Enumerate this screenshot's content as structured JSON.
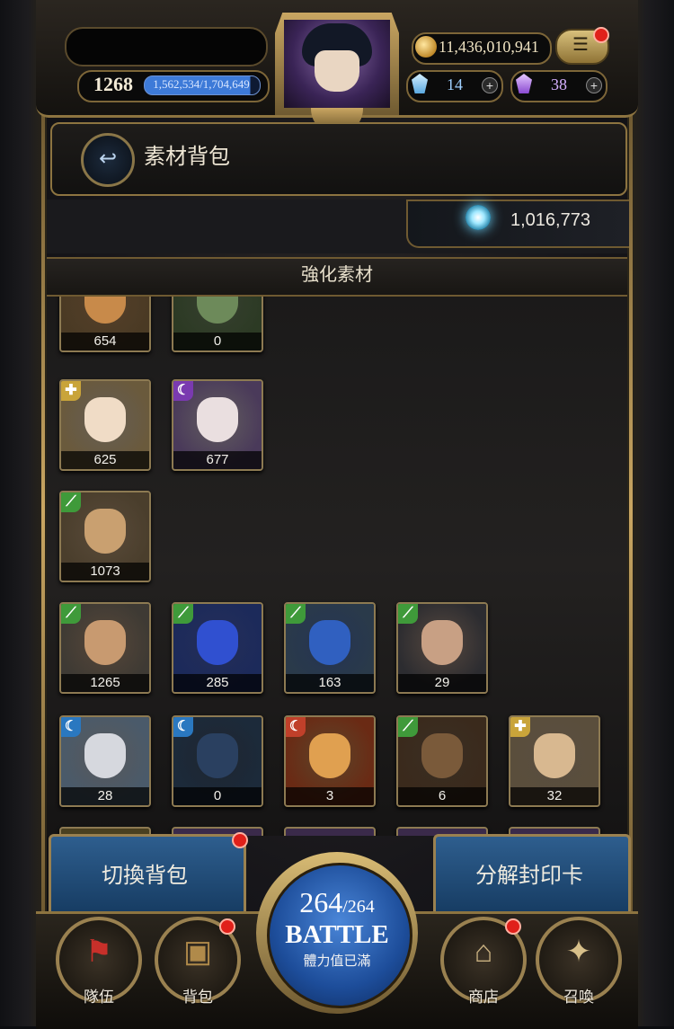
{
  "player": {
    "level": "1268",
    "exp": "1,562,534/1,704,649",
    "exp_fraction": 0.9167
  },
  "currency": {
    "gold": "11,436,010,941",
    "gem_blue": "14",
    "gem_purple": "38",
    "plus": "+",
    "material_points": "1,016,773"
  },
  "menu": {
    "icon": "hamburger-menu-icon",
    "glyph": "☰"
  },
  "header": {
    "title": "素材背包",
    "back_icon": "back-arrow-icon",
    "back_glyph": "↩"
  },
  "section": {
    "title": "強化素材"
  },
  "attribute_glyphs": {
    "wood": "⟋",
    "light": "✚",
    "dark": "☾",
    "water": "☾",
    "fire": "☾"
  },
  "cards": [
    {
      "count": "654",
      "attr": "wood",
      "glyph": "⟋",
      "bg": "#4a3a24",
      "face": "#c88a4a"
    },
    {
      "count": "0",
      "attr": "wood",
      "glyph": "⟋",
      "bg": "#2c3a24",
      "face": "#6d8a5a"
    },
    {
      "count": "625",
      "attr": "light",
      "glyph": "✚",
      "bg": "#6a5a3c",
      "face": "#f0dcc6"
    },
    {
      "count": "677",
      "attr": "dark",
      "glyph": "☾",
      "bg": "#4a3a5a",
      "face": "#eadfe0"
    },
    {
      "count": "1073",
      "attr": "wood",
      "glyph": "⟋",
      "bg": "#4a3e2c",
      "face": "#c9a070"
    },
    {
      "count": "1265",
      "attr": "wood",
      "glyph": "⟋",
      "bg": "#3e3a34",
      "face": "#c89a70"
    },
    {
      "count": "285",
      "attr": "wood",
      "glyph": "⟋",
      "bg": "#1c2a5a",
      "face": "#3050d0"
    },
    {
      "count": "163",
      "attr": "wood",
      "glyph": "⟋",
      "bg": "#2a3a4a",
      "face": "#3060c0"
    },
    {
      "count": "29",
      "attr": "wood",
      "glyph": "⟋",
      "bg": "#2c2c30",
      "face": "#c8a084"
    },
    {
      "count": "28",
      "attr": "water",
      "glyph": "☾",
      "bg": "#4a5a6a",
      "face": "#d6d8de"
    },
    {
      "count": "0",
      "attr": "water",
      "glyph": "☾",
      "bg": "#1c2a3a",
      "face": "#2a4060"
    },
    {
      "count": "3",
      "attr": "fire",
      "glyph": "☾",
      "bg": "#6a2a14",
      "face": "#e0a050"
    },
    {
      "count": "6",
      "attr": "wood",
      "glyph": "⟋",
      "bg": "#3a2a1c",
      "face": "#7a5a3a"
    },
    {
      "count": "32",
      "attr": "light",
      "glyph": "✚",
      "bg": "#5a4e3c",
      "face": "#d8b890"
    }
  ],
  "buttons": {
    "switch_bag": "切換背包",
    "disassemble": "分解封印卡"
  },
  "battle": {
    "stamina_current": "264",
    "stamina_max": "/264",
    "label": "BATTLE",
    "status": "體力值已滿"
  },
  "nav": [
    {
      "label": "隊伍",
      "icon": "flag-icon",
      "glyph": "⚑",
      "badge": false
    },
    {
      "label": "背包",
      "icon": "chest-icon",
      "glyph": "▣",
      "badge": true
    },
    {
      "label": "商店",
      "icon": "shop-icon",
      "glyph": "⌂",
      "badge": true
    },
    {
      "label": "召喚",
      "icon": "summon-card-icon",
      "glyph": "✦",
      "badge": false
    }
  ],
  "colors": {
    "wood": "#3f9a3a",
    "light": "#c9a43a",
    "dark": "#7a3ab0",
    "water": "#2a78c0",
    "fire": "#c0402a",
    "badge": "#e0201a"
  }
}
